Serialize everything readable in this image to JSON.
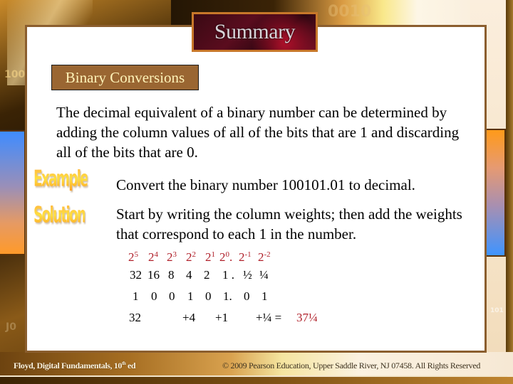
{
  "slide": {
    "title": "Summary",
    "subtitle": "Binary Conversions",
    "intro": "The decimal equivalent of a binary number can be determined by adding the column values of all of the bits that are 1 and discarding all of the bits that are 0.",
    "example_label": "Example",
    "example_text": "Convert the binary number 100101.01 to decimal.",
    "solution_label": "Solution",
    "solution_text": "Start by writing the column weights; then add the weights that correspond to each 1 in the number."
  },
  "conversion": {
    "powers": [
      {
        "base": "2",
        "exp": "5"
      },
      {
        "base": "2",
        "exp": "4"
      },
      {
        "base": "2",
        "exp": "3"
      },
      {
        "base": "2",
        "exp": "2"
      },
      {
        "base": "2",
        "exp": "1"
      },
      {
        "base": "2",
        "exp": "0",
        "suffix": "."
      },
      {
        "base": "2",
        "exp": "-1"
      },
      {
        "base": "2",
        "exp": "-2"
      }
    ],
    "weights": [
      "32",
      "16",
      "8",
      "4",
      "2",
      "1 .",
      "½",
      "¼"
    ],
    "bits": [
      "1",
      "0",
      "0",
      "1",
      "0",
      "1.",
      "0",
      "1"
    ],
    "sum_terms": [
      "32",
      "+4",
      "+1",
      "+¼ ="
    ],
    "result": "37¼"
  },
  "footer": {
    "left_main": "Floyd, Digital Fundamentals, 10",
    "left_sup": "th",
    "left_end": " ed",
    "right": "© 2009 Pearson Education, Upper Saddle River, NJ 07458. All Rights Reserved"
  },
  "background_marks": [
    "100",
    "0010",
    "J0",
    "101"
  ],
  "colors": {
    "panel_border": "#8b5e2e",
    "subtitle_bg": "#9a6632",
    "subtitle_text": "#fff3b8",
    "accent_red": "#b0202a"
  }
}
